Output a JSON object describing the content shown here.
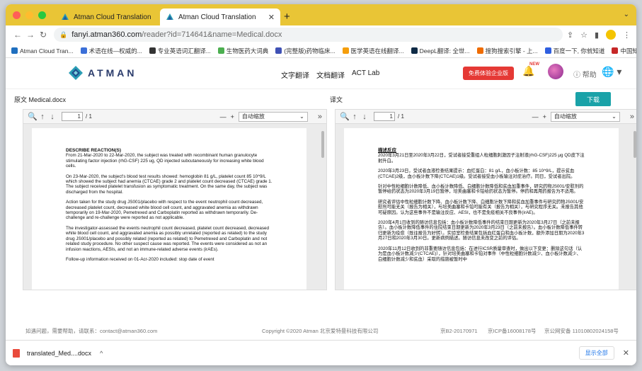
{
  "browser": {
    "tabs": [
      {
        "title": "Atman Cloud Translation",
        "active": false
      },
      {
        "title": "Atman Cloud Translation",
        "active": true
      }
    ],
    "new_tab": "+",
    "tab_menu": "⌄",
    "url_host": "fanyi.atman360.com",
    "url_path": "/reader?id=714641&name=Medical.docx",
    "bookmarks": [
      {
        "label": "Atman Cloud Tran...",
        "color": "#1f6fbf"
      },
      {
        "label": "术语在线—权威的...",
        "color": "#3b6fd8"
      },
      {
        "label": "专业英语词汇翻译...",
        "color": "#333333"
      },
      {
        "label": "生物医药大词典",
        "color": "#4caf50"
      },
      {
        "label": "(完整版)药物临床...",
        "color": "#3f51b5"
      },
      {
        "label": "医学英语在线翻译...",
        "color": "#f59e0b"
      },
      {
        "label": "DeepL翻译: 全世...",
        "color": "#0f2b46"
      },
      {
        "label": "搜狗搜索引擎 - 上...",
        "color": "#ef6c00"
      },
      {
        "label": "百度一下, 你就知道",
        "color": "#2f5fe0"
      },
      {
        "label": "中国知网",
        "color": "#c62828"
      }
    ],
    "bookmarks_more": "»"
  },
  "app": {
    "brand": "ATMAN",
    "nav": [
      "文字翻译",
      "文档翻译",
      "ACT Lab"
    ],
    "trial_button": "免费体验企业版",
    "bell_badge": "NEW",
    "help": "帮助",
    "download_button": "下载",
    "source_pane_title": "原文 Medical.docx",
    "target_pane_title": "译文"
  },
  "viewer": {
    "page_current": "1",
    "page_total": "/ 1",
    "zoom": "自动缩放",
    "zoom_minus": "—",
    "zoom_plus": "+",
    "sidebar_toggle": "»"
  },
  "source_doc": {
    "heading": "DESCRIBE REACTION(S)",
    "paragraphs": [
      "From 21-Mar-2020 to 22-Mar-2020, the subject was treated with recombinant human granulocyte stimulating factor injection (rhG-CSF) 225 ug, QD injected subcutaneously for increasing white blood cells.",
      "On 23-Mar-2020, the subject's blood test results showed: hemoglobin 81 g/L, platelet count 85 10^9/L which showed the subject had anemia (CTCAE) grade 2 and platelet count decreased (CTCAE) grade 1. The subject received platelet transfusion as symptomatic treatment. On the same day, the subject was discharged from the hospital.",
      "Action taken for the study drug JS001/placebo with respect to the event neutrophil count decreased, decreased platelet count, decreased white blood cell count, and aggravated anemia as withdrawn temporarily on 19-Mar-2020, Pemetrexed and Carboplatin reported as withdrawn temporarily. De-challenge and re-challenge were reported as not applicable.",
      "The investigator-assessed the events neutrophil count decreased, platelet count decreased, decreased white blood cell count, and aggravated anemia as possibly unrelated (reported as related) to the study drug JS001/placebo and possibly related (reported as related) to Pemetrexed and Carboplatin and not related study procedure. No other suspect cause was reported. The events were considered as not an infusion reactions, AESIs, and not an immune-related adverse events (irAEs).",
      "Follow-up information received on 01-Acr-2020 included: stop date of event"
    ]
  },
  "target_doc": {
    "heading": "描述反应",
    "paragraphs": [
      "2020年3月21日至2020年3月22日，受试者接受重组人粒细胞刺激因子注射液(rhG-CSF)225 μg QD皮下注射升白。",
      "2020年3月23日，受试者血液检查结果提示：血红蛋白：81 g/L，血小板计数：85 10^9/L，提示贫血(CTCAE)2级，血小板计数下降(CTCAE)1级。受试者接受血小板输注对症治疗。同日，受试者出院。",
      "针对中性粒细胞计数降低、血小板计数降低、白细胞计数降低和贫血加重事件，研究药物JS001/安慰剂的暂停给药状态为2020年3月19日暂停，培美曲塞和卡铂给药状态为暂停。停药和再用药报告为不适用。",
      "研究者评估中性粒细胞计数下降、血小板计数下降、白细胞计数下降和贫血加重事件与研究药物JS001/安慰剂可能无关（报告为相关），与培美曲塞和卡铂可能有关（报告为相关），与研究程序无关。未报告其他可疑原因。认为这些事件不是输注反应、AESI，也不是免疫相关不良事件(irAE)。",
      "2020年4月1日收到的随访信息包括：血小板计数降低事件的结束日期更新为2020年3月27日（之前未报告）。血小板计数降低事件的住院结束日期更新为2020年3月23日（之前未报告）。血小板计数降低事件转归更新为痊愈（既往报告为好转）。实验室检查结果包括血红蛋白和血小板计数，额外添加日期为2020年3月27日和2020年3月30日。更新病例描述。随访信息未改变之前的评估。",
      "2020年11月12日收到的非重要随访信息包括：在进行ICSR质量审查时，做出以下变更：删除这句话（认为是血小板计数减少(CTCAE)），针对培美曲塞和卡铂对事件（中性粒细胞计数减少、血小板计数减少、白细胞计数减少和贫血）采取的措施被暂时中"
    ]
  },
  "footer": {
    "contact": "如遇问题，需要帮助，请联系：contact@atman360.com",
    "copyright": "Copyright ©2020 Atman  北京爱特曼科技有限公司",
    "icp1": "京B2-20170971",
    "icp2": "京ICP备16008178号",
    "police": "京公网安备 11010802024158号"
  },
  "downloads": {
    "filename": "translated_Med....docx",
    "show_all": "显示全部"
  },
  "colors": {
    "tabstrip": "#e9c536",
    "accent_teal": "#1aa2a8",
    "trial_red": "#e53935"
  }
}
